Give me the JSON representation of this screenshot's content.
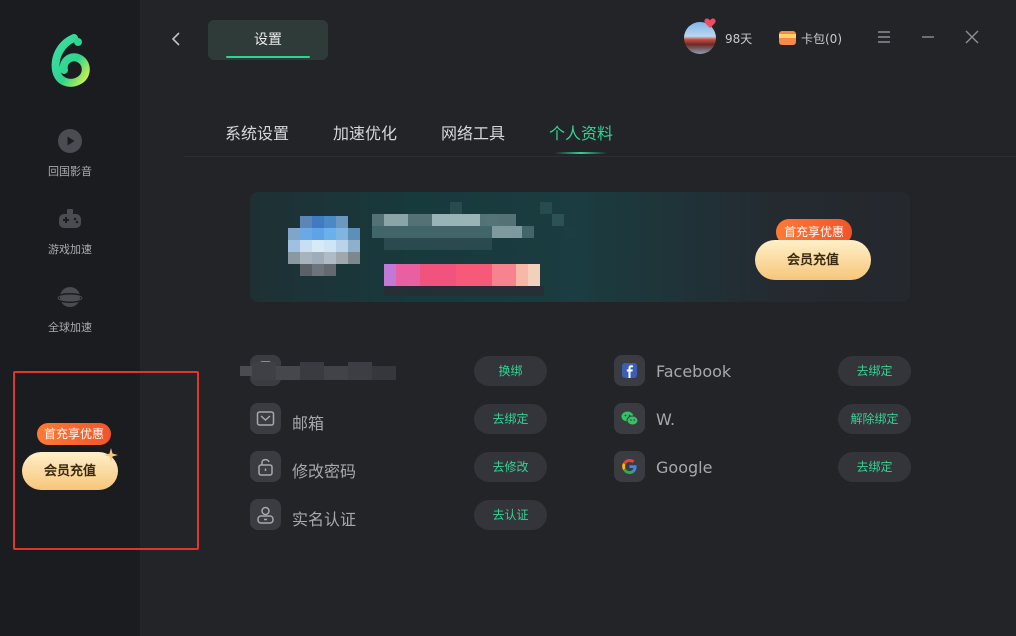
{
  "sidebar": {
    "items": [
      {
        "label": "回国影音",
        "icon": "play-icon"
      },
      {
        "label": "游戏加速",
        "icon": "gamepad-icon"
      },
      {
        "label": "全球加速",
        "icon": "planet-icon"
      }
    ],
    "promo_tag": "首充享优惠",
    "vip_button": "会员充值"
  },
  "header": {
    "title": "设置",
    "days_remaining": "98天",
    "wallet_label": "卡包(0)"
  },
  "tabs": [
    {
      "label": "系统设置",
      "active": false
    },
    {
      "label": "加速优化",
      "active": false
    },
    {
      "label": "网络工具",
      "active": false
    },
    {
      "label": "个人资料",
      "active": true
    }
  ],
  "banner": {
    "promo_tag": "首充享优惠",
    "vip_button": "会员充值"
  },
  "account_left": [
    {
      "label": "",
      "icon": "phone-icon",
      "action": "换绑"
    },
    {
      "label": "邮箱",
      "icon": "mail-icon",
      "action": "去绑定"
    },
    {
      "label": "修改密码",
      "icon": "lock-icon",
      "action": "去修改"
    },
    {
      "label": "实名认证",
      "icon": "id-card-icon",
      "action": "去认证"
    }
  ],
  "account_right": [
    {
      "label": "Facebook",
      "icon": "facebook-icon",
      "action": "去绑定"
    },
    {
      "label": "W.",
      "icon": "wechat-icon",
      "action": "解除绑定"
    },
    {
      "label": "Google",
      "icon": "google-icon",
      "action": "去绑定"
    }
  ],
  "colors": {
    "accent": "#2fd48f",
    "background": "#232428",
    "sidebar": "#1b1c1f",
    "promo": "#f0542a",
    "highlight_box": "#e2352c"
  }
}
